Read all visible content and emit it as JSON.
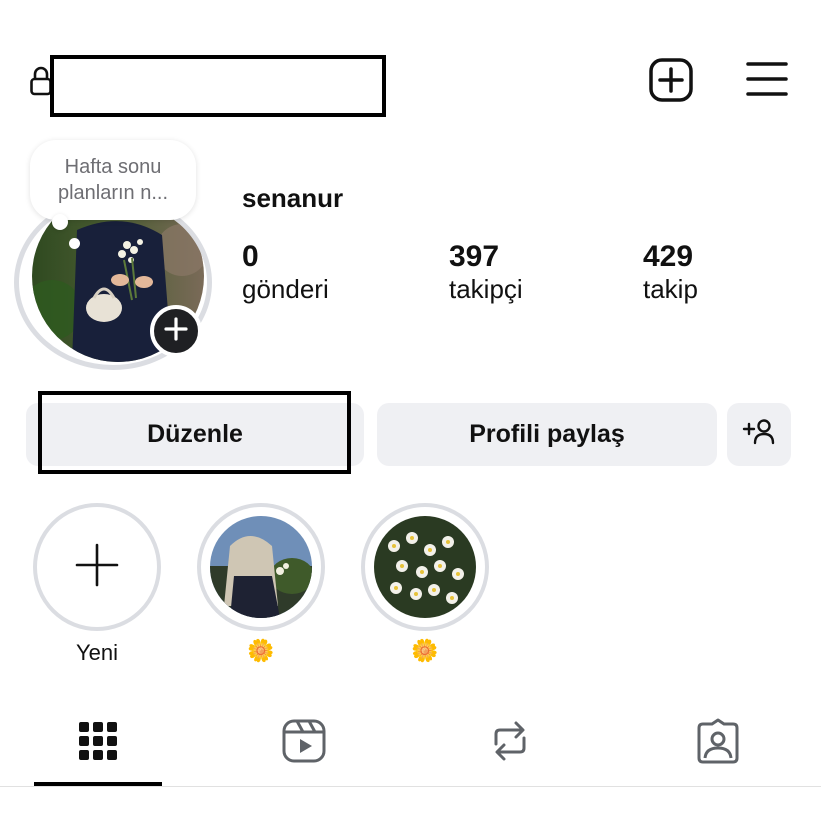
{
  "header": {
    "lock_icon": "lock-icon",
    "create_icon": "plus-square-icon",
    "menu_icon": "hamburger-menu-icon"
  },
  "note": {
    "line1": "Hafta sonu",
    "line2": "planların n..."
  },
  "profile": {
    "display_name": "senanur",
    "stats": [
      {
        "value": "0",
        "label": "gönderi"
      },
      {
        "value": "397",
        "label": "takipçi"
      },
      {
        "value": "429",
        "label": "takip"
      }
    ]
  },
  "actions": {
    "edit_label": "Düzenle",
    "share_label": "Profili paylaş",
    "add_person_icon": "add-person-icon"
  },
  "highlights": [
    {
      "label": "Yeni",
      "icon": "plus-icon"
    },
    {
      "label": "🌼"
    },
    {
      "label": "🌼"
    }
  ],
  "tabs": [
    {
      "icon": "grid-icon",
      "active": true
    },
    {
      "icon": "reels-icon",
      "active": false
    },
    {
      "icon": "repost-icon",
      "active": false
    },
    {
      "icon": "tagged-icon",
      "active": false
    }
  ],
  "colors": {
    "button_bg": "#eff0f3",
    "ring": "#dbdde2",
    "icon_gray": "#5f6368"
  }
}
